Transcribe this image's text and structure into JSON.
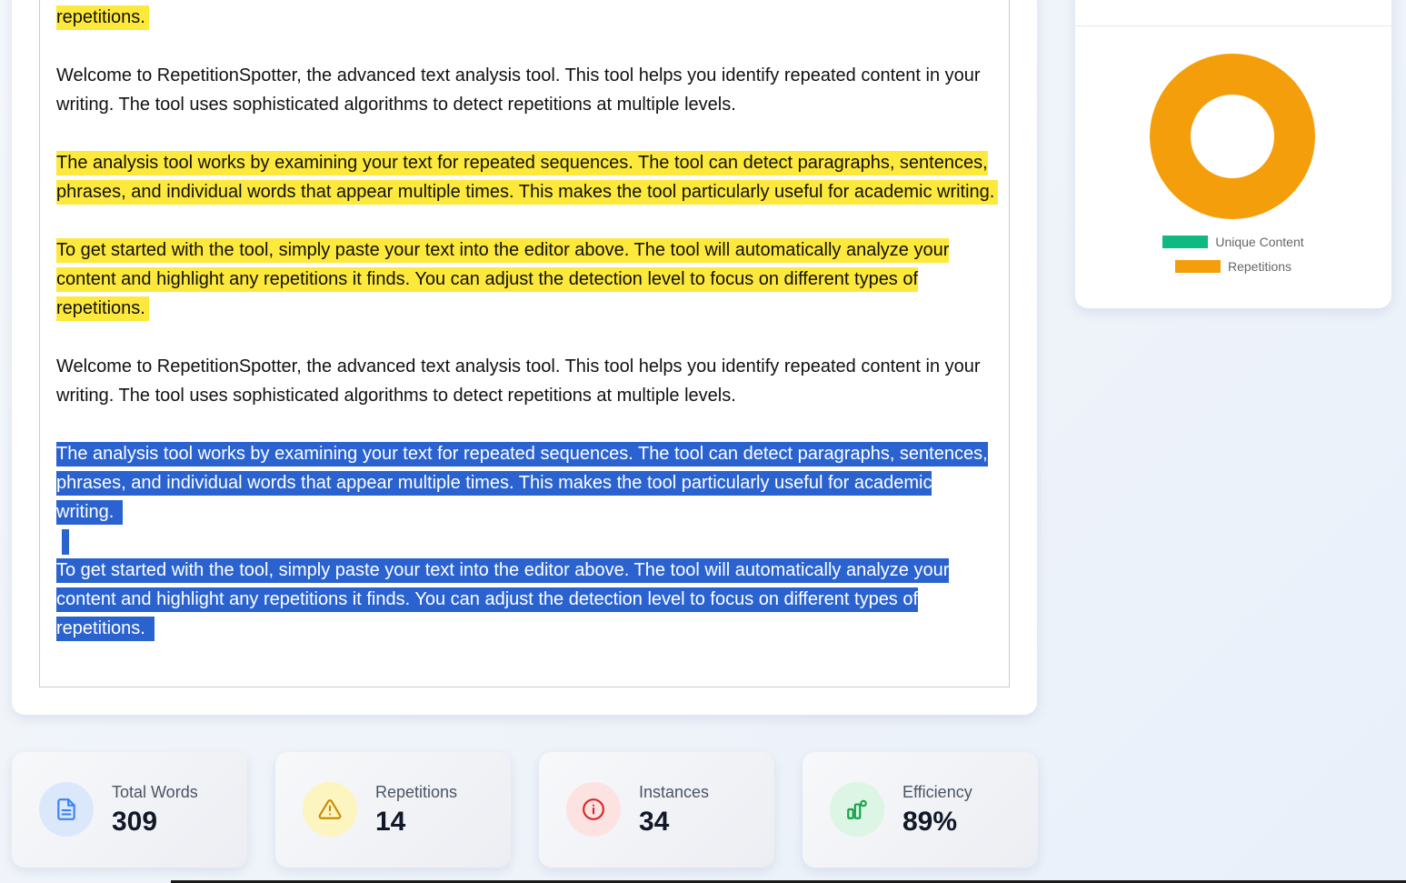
{
  "editor": {
    "paragraphs": [
      {
        "text": "repetitions.",
        "highlight": "yellow"
      },
      {
        "text": "Welcome to RepetitionSpotter, the advanced text analysis tool. This tool helps you identify repeated content in your writing. The tool uses sophisticated algorithms to detect repetitions at multiple levels.",
        "highlight": "none"
      },
      {
        "text": "The analysis tool works by examining your text for repeated sequences. The tool can detect paragraphs, sentences, phrases, and individual words that appear multiple times. This makes the tool particularly useful for academic writing.",
        "highlight": "yellow"
      },
      {
        "text": "To get started with the tool, simply paste your text into the editor above. The tool will automatically analyze your content and highlight any repetitions it finds. You can adjust the detection level to focus on different types of repetitions.",
        "highlight": "yellow"
      },
      {
        "text": "Welcome to RepetitionSpotter, the advanced text analysis tool. This tool helps you identify repeated content in your writing. The tool uses sophisticated algorithms to detect repetitions at multiple levels.",
        "highlight": "none"
      },
      {
        "text": "The analysis tool works by examining your text for repeated sequences. The tool can detect paragraphs, sentences, phrases, and individual words that appear multiple times. This makes the tool particularly useful for academic writing.",
        "highlight": "selected"
      },
      {
        "text": "To get started with the tool, simply paste your text into the editor above. The tool will automatically analyze your content and highlight any repetitions it finds. You can adjust the detection level to focus on different types of repetitions.",
        "highlight": "selected"
      }
    ]
  },
  "chart": {
    "legend": {
      "unique_label": "Unique Content",
      "repetitions_label": "Repetitions"
    }
  },
  "chart_data": {
    "type": "pie",
    "categories": [
      "Unique Content",
      "Repetitions"
    ],
    "values": [
      0,
      100
    ],
    "colors": [
      "#10b981",
      "#f59e0b"
    ],
    "title": "",
    "legend_position": "bottom"
  },
  "stats": [
    {
      "label": "Total Words",
      "value": "309",
      "icon": "document-icon",
      "icon_color": "#3b82f6",
      "icon_bg": "#dbe8fb"
    },
    {
      "label": "Repetitions",
      "value": "14",
      "icon": "warning-icon",
      "icon_color": "#ca8a04",
      "icon_bg": "#fdf5c0"
    },
    {
      "label": "Instances",
      "value": "34",
      "icon": "info-icon",
      "icon_color": "#dc2626",
      "icon_bg": "#fde2e2"
    },
    {
      "label": "Efficiency",
      "value": "89%",
      "icon": "efficiency-icon",
      "icon_color": "#16a34a",
      "icon_bg": "#dcf5e4"
    }
  ]
}
